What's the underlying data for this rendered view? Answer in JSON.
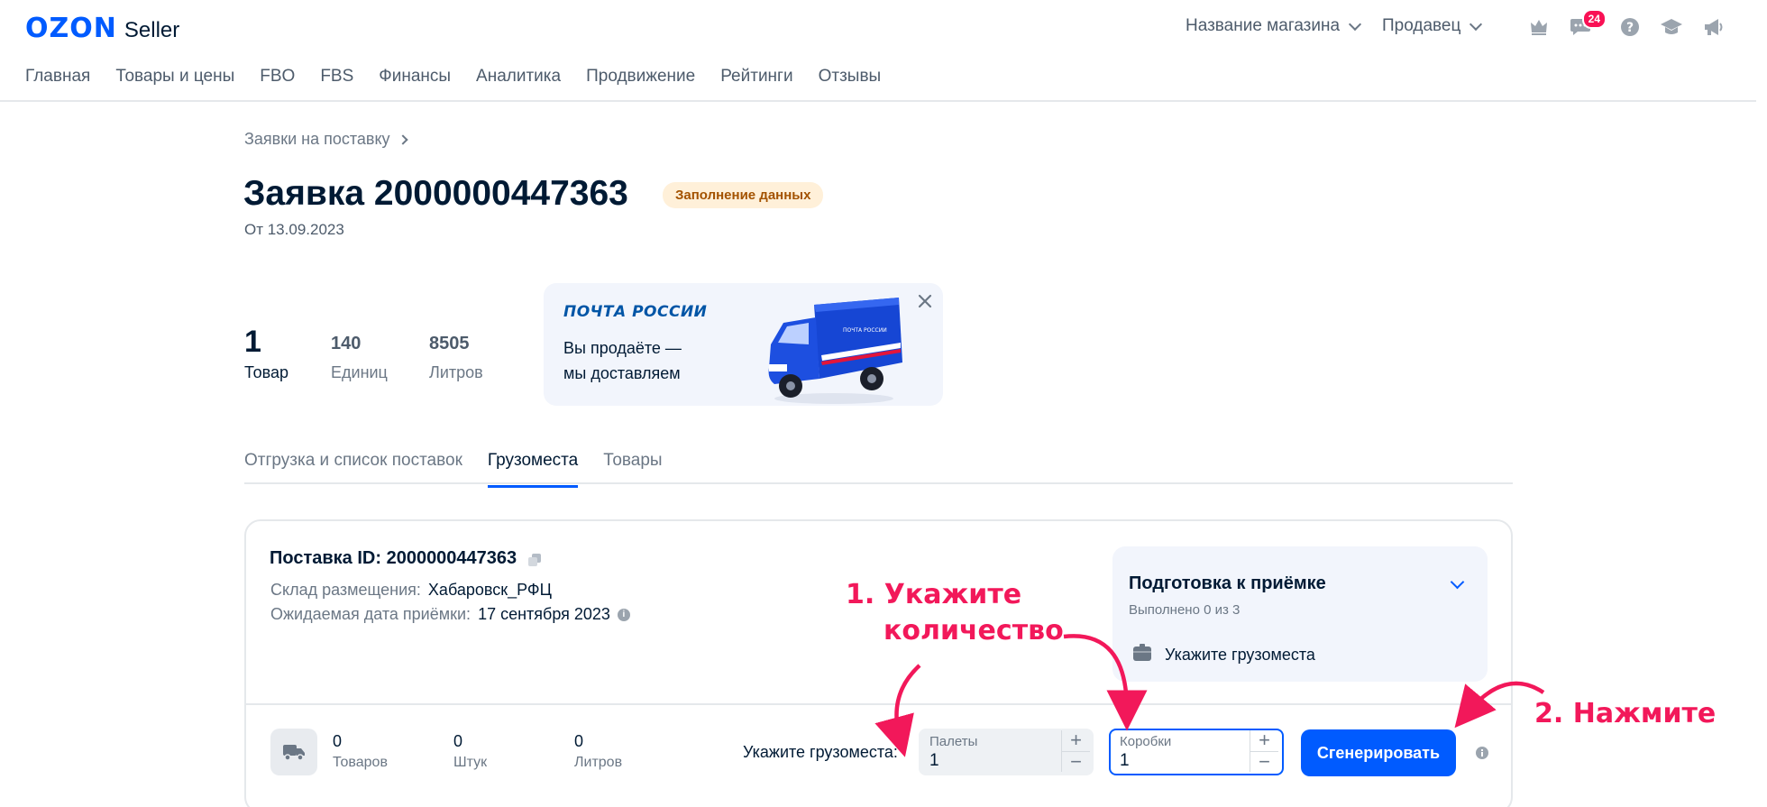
{
  "header": {
    "logo_brand": "OZON",
    "logo_product": "Seller",
    "store_name": "Название магазина",
    "role": "Продавец",
    "messages_badge": "24",
    "icons": [
      "crown-icon",
      "chat-icon",
      "help-icon",
      "education-icon",
      "megaphone-icon"
    ]
  },
  "nav": {
    "items": [
      "Главная",
      "Товары и цены",
      "FBO",
      "FBS",
      "Финансы",
      "Аналитика",
      "Продвижение",
      "Рейтинги",
      "Отзывы"
    ]
  },
  "breadcrumb": {
    "label": "Заявки на поставку"
  },
  "order": {
    "title": "Заявка 2000000447363",
    "status": "Заполнение данных",
    "date": "От 13.09.2023"
  },
  "stats": [
    {
      "value": "1",
      "label": "Товар"
    },
    {
      "value": "140",
      "label": "Единиц"
    },
    {
      "value": "8505",
      "label": "Литров"
    }
  ],
  "promo": {
    "brand": "ПОЧТА РОССИИ",
    "line1": "Вы продаёте —",
    "line2": "мы доставляем",
    "truck_text": "ПОЧТА РОССИИ"
  },
  "tabs": [
    "Отгрузка и список поставок",
    "Грузоместа",
    "Товары"
  ],
  "active_tab": "Грузоместа",
  "supply": {
    "id_label": "Поставка ID: 2000000447363",
    "warehouse_label": "Склад размещения:",
    "warehouse_value": "Хабаровск_РФЦ",
    "date_label": "Ожидаемая дата приёмки:",
    "date_value": "17 сентября 2023"
  },
  "preparation": {
    "title": "Подготовка к приёмке",
    "progress": "Выполнено 0 из 3",
    "step": "Укажите грузоместа"
  },
  "counts": [
    {
      "value": "0",
      "label": "Товаров"
    },
    {
      "value": "0",
      "label": "Штук"
    },
    {
      "value": "0",
      "label": "Литров"
    }
  ],
  "cargo": {
    "label": "Укажите грузоместа:",
    "pallets_label": "Палеты",
    "pallets_value": "1",
    "boxes_label": "Коробки",
    "boxes_value": "1",
    "plus": "+",
    "minus": "−",
    "generate_button": "Сгенерировать"
  },
  "annotations": {
    "step1_line1": "1. Укажите",
    "step1_line2": "количество",
    "step2": "2. Нажмите",
    "color": "#f2185a"
  },
  "colors": {
    "accent": "#005bff",
    "status_bg": "#fff0d9",
    "status_text": "#a35200",
    "badge": "#f91155"
  }
}
